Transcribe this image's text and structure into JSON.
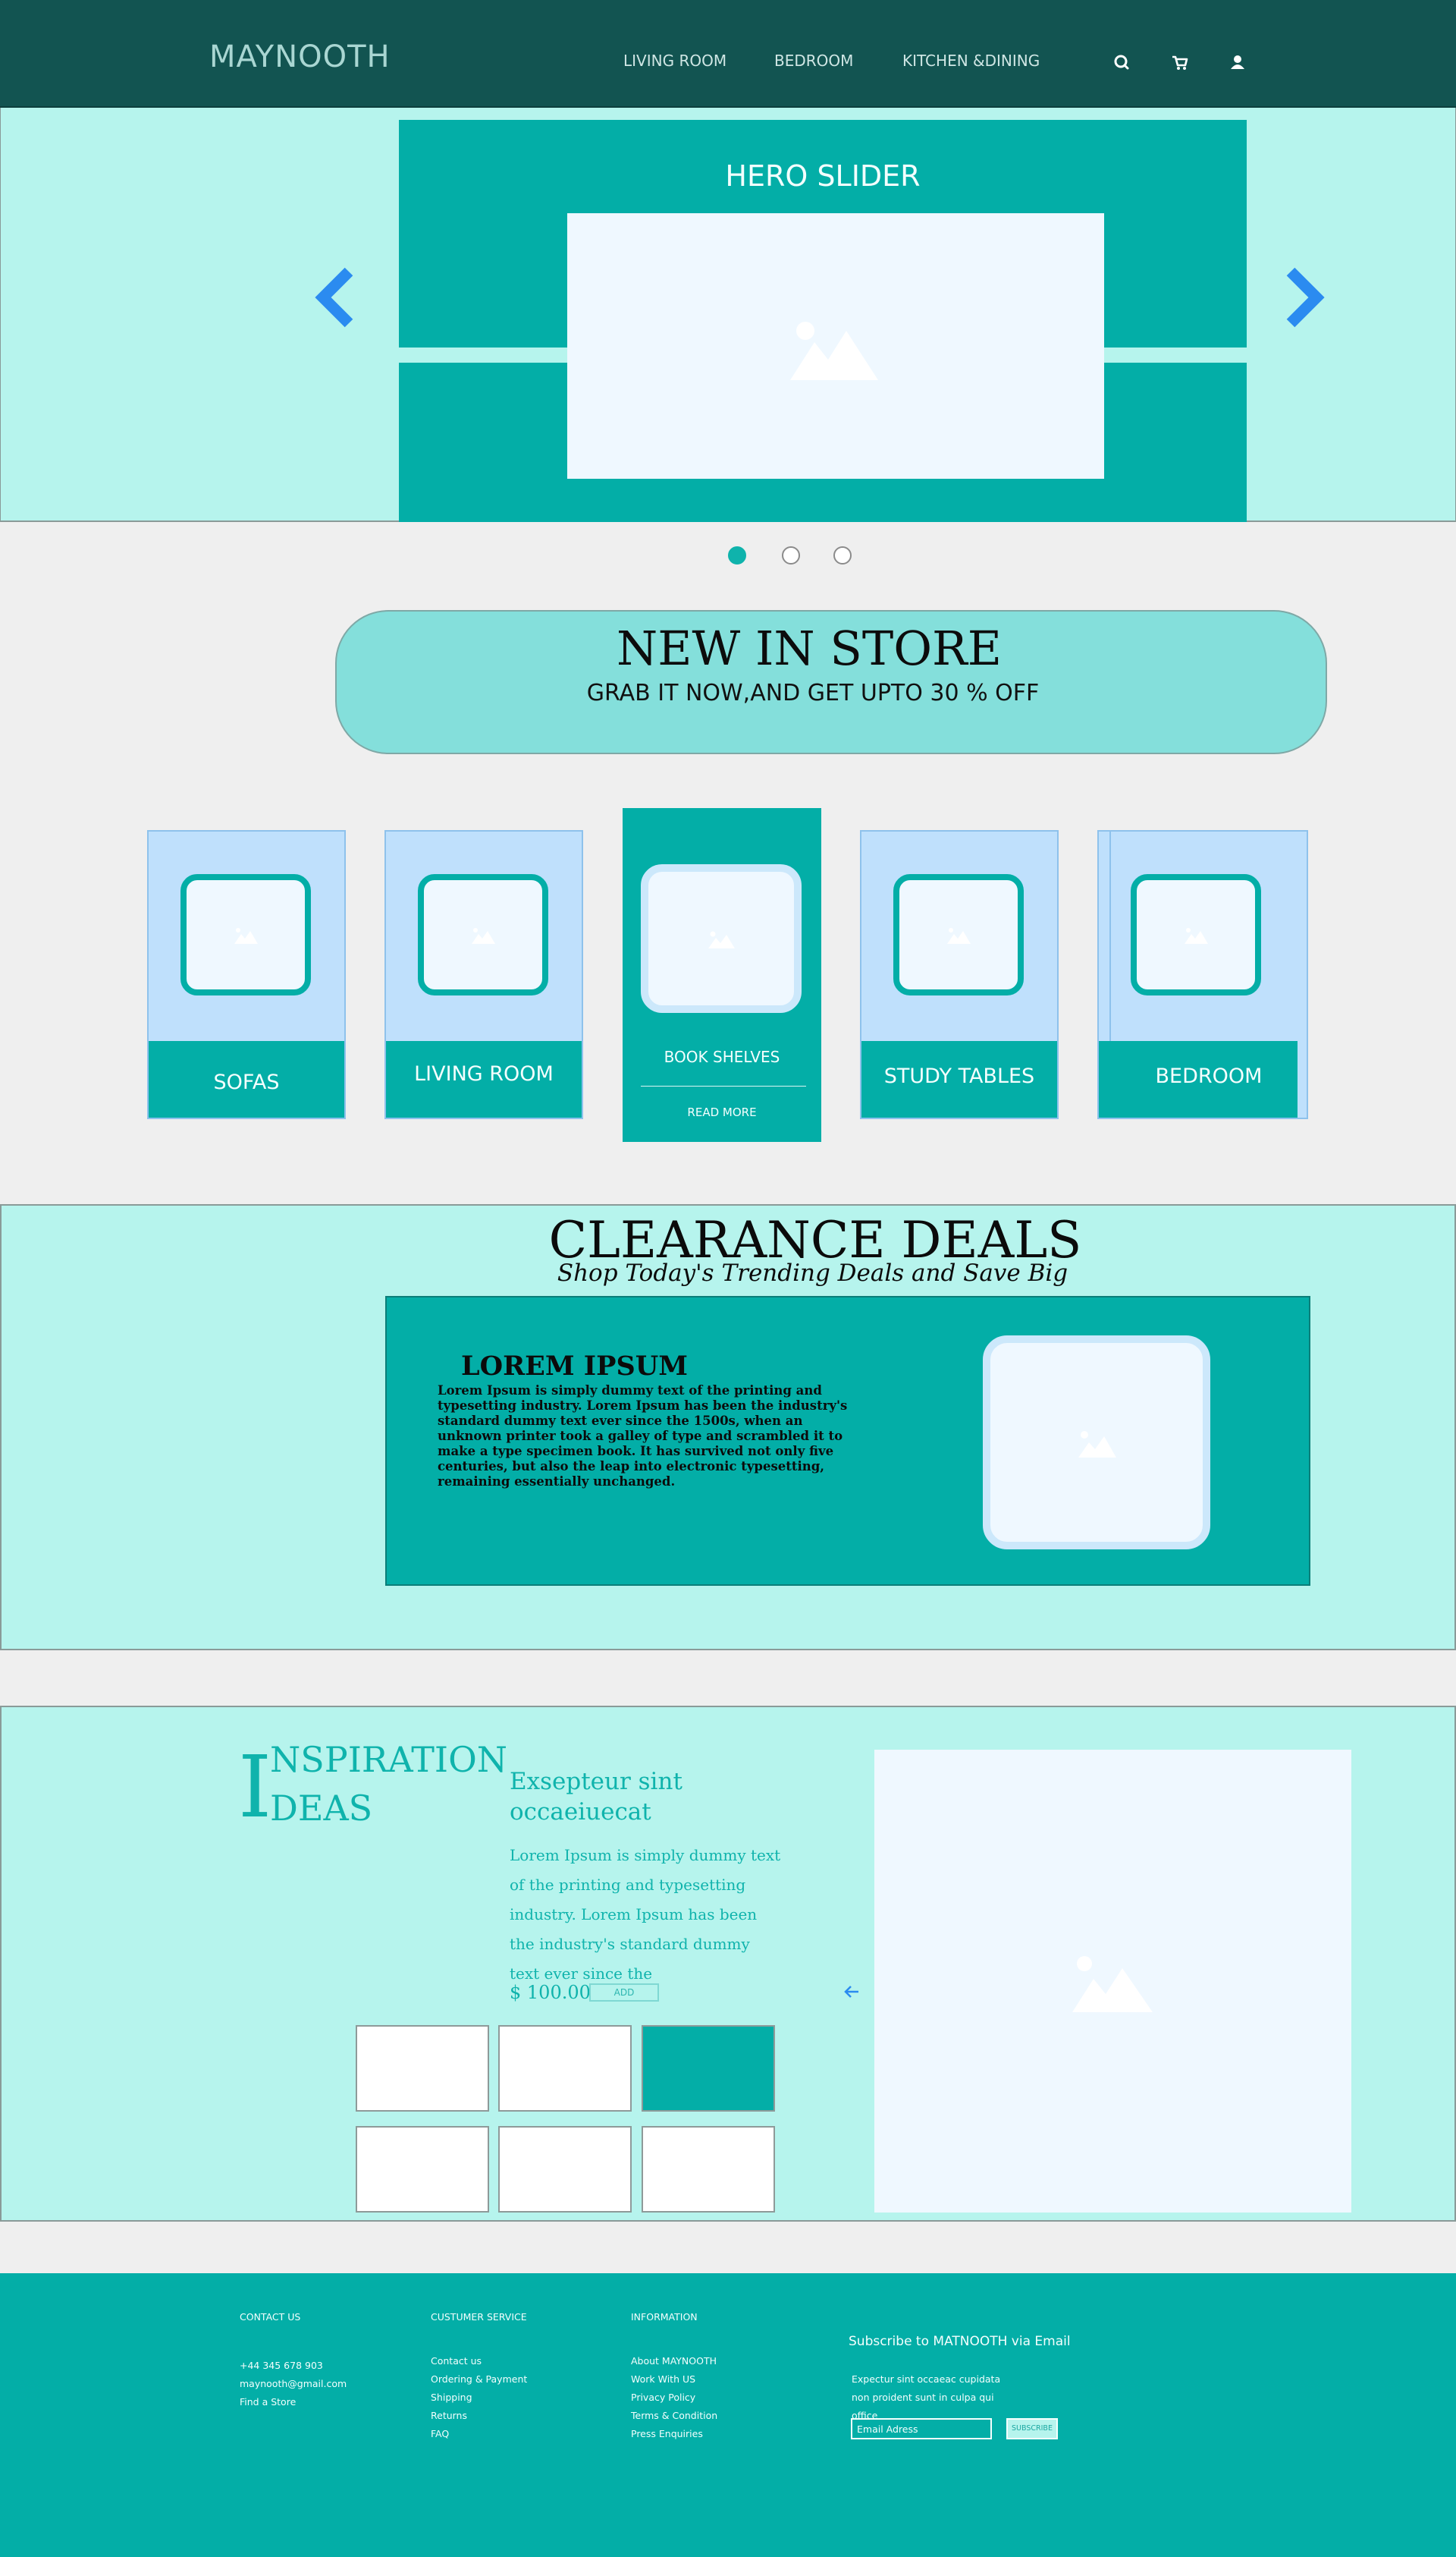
{
  "header": {
    "logo": "MAYNOOTH",
    "nav": [
      "LIVING ROOM",
      "BEDROOM",
      "KITCHEN &DINING"
    ],
    "icons": [
      "search-icon",
      "cart-icon",
      "user-icon"
    ]
  },
  "hero": {
    "title": "HERO SLIDER",
    "dots_count": 3,
    "active_dot": 1
  },
  "store": {
    "title": "NEW IN STORE",
    "subtitle": "GRAB IT NOW,AND GET UPTO  30 % OFF"
  },
  "categories": {
    "sofas": "SOFAS",
    "living_room": "LIVING ROOM",
    "book_shelves": "BOOK SHELVES",
    "read_more": "READ MORE",
    "study_tables": "STUDY TABLES",
    "bedroom": "BEDROOM"
  },
  "clearance": {
    "title": "CLEARANCE DEALS",
    "subtitle": "Shop Today's Trending Deals and Save Big",
    "heading": "LOREM IPSUM",
    "text": "Lorem Ipsum is simply dummy text of the printing and typesetting industry. Lorem Ipsum has been the industry's standard dummy text ever since the 1500s, when an unknown printer took a galley of type and scrambled it to make a type specimen book. It has survived not only five centuries, but also the leap into electronic typesetting, remaining essentially unchanged."
  },
  "inspiration": {
    "big_letter": "I",
    "line1": "NSPIRATION",
    "line2": "DEAS",
    "heading": "Exsepteur sint occaeiuecat",
    "text": "Lorem Ipsum is simply dummy text of the printing and typesetting industry. Lorem Ipsum has been the industry's standard dummy text ever since the",
    "price": "$ 100.00",
    "add": "ADD"
  },
  "footer": {
    "contact": {
      "title": "CONTACT US",
      "items": [
        "+44 345 678 903",
        "maynooth@gmail.com",
        "Find a Store"
      ]
    },
    "service": {
      "title": "CUSTUMER SERVICE",
      "items": [
        "Contact  us",
        "Ordering & Payment",
        "Shipping",
        "Returns",
        "FAQ"
      ]
    },
    "information": {
      "title": "INFORMATION",
      "items": [
        "About MAYNOOTH",
        "Work With US",
        "Privacy Policy",
        "Terms & Condition",
        "Press Enquiries"
      ]
    },
    "subscribe": {
      "title": "Subscribe to MATNOOTH  via  Email",
      "text": "Expectur sint occaeac cupidata non proident sunt in culpa qui office",
      "placeholder": "Email Adress",
      "button": "SUBSCRIBE"
    }
  },
  "colors": {
    "header": "#125451",
    "mint": "#b6f4ed",
    "teal": "#03aea7",
    "card_blue": "#bfe0fc",
    "arrow_blue": "#2b8bf0"
  }
}
